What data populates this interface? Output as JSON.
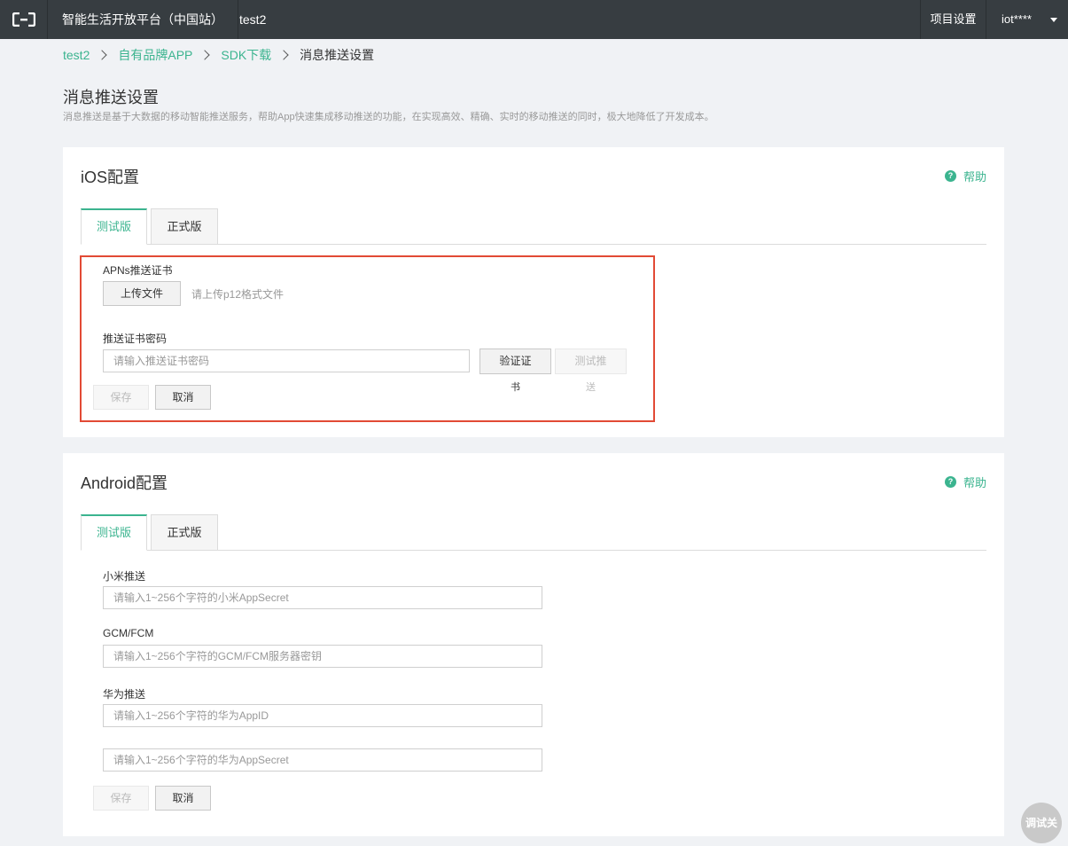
{
  "topbar": {
    "logo_icon": "aliyun-bracket-logo",
    "platform": "智能生活开放平台（中国站）",
    "project": "test2",
    "project_settings": "项目设置",
    "user": "iot****"
  },
  "breadcrumb": {
    "items": [
      "test2",
      "自有品牌APP",
      "SDK下载"
    ],
    "current": "消息推送设置"
  },
  "page": {
    "title": "消息推送设置",
    "description": "消息推送是基于大数据的移动智能推送服务，帮助App快速集成移动推送的功能，在实现高效、精确、实时的移动推送的同时，极大地降低了开发成本。"
  },
  "ios": {
    "title": "iOS配置",
    "help": "帮助",
    "tabs": [
      "测试版",
      "正式版"
    ],
    "apns_label": "APNs推送证书",
    "upload_button": "上传文件",
    "upload_hint": "请上传p12格式文件",
    "password_label": "推送证书密码",
    "password_placeholder": "请输入推送证书密码",
    "verify_button_line1": "验证证",
    "verify_button_line2": "书",
    "test_push_line1": "测试推",
    "test_push_line2": "送",
    "save": "保存",
    "cancel": "取消"
  },
  "android": {
    "title": "Android配置",
    "help": "帮助",
    "tabs": [
      "测试版",
      "正式版"
    ],
    "xiaomi_label": "小米推送",
    "xiaomi_placeholder": "请输入1~256个字符的小米AppSecret",
    "gcm_label": "GCM/FCM",
    "gcm_placeholder": "请输入1~256个字符的GCM/FCM服务器密钥",
    "huawei_label": "华为推送",
    "huawei_appid_placeholder": "请输入1~256个字符的华为AppID",
    "huawei_secret_placeholder": "请输入1~256个字符的华为AppSecret",
    "save": "保存",
    "cancel": "取消"
  },
  "debug_float": "调试关",
  "colors": {
    "accent": "#3bb48f",
    "topbar": "#373d41",
    "highlight": "#e24a35"
  }
}
